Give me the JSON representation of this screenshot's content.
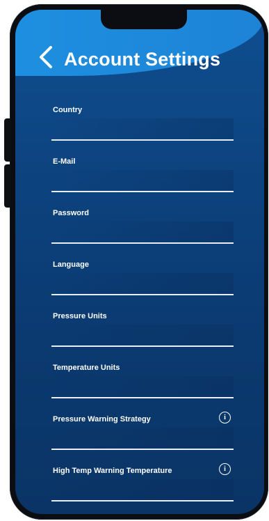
{
  "header": {
    "title": "Account Settings"
  },
  "fields": [
    {
      "label": "Country",
      "value": ""
    },
    {
      "label": "E-Mail",
      "value": ""
    },
    {
      "label": "Password",
      "value": ""
    },
    {
      "label": "Language",
      "value": ""
    },
    {
      "label": "Pressure Units",
      "value": ""
    },
    {
      "label": "Temperature Units",
      "value": ""
    },
    {
      "label": "Pressure Warning Strategy",
      "value": "",
      "info_icon": "info-icon"
    },
    {
      "label": "High Temp Warning Temperature",
      "value": "",
      "info_icon": "info-icon"
    }
  ],
  "colors": {
    "header": "#1e8fe0",
    "background": "#0b3c74",
    "text": "#ffffff"
  }
}
